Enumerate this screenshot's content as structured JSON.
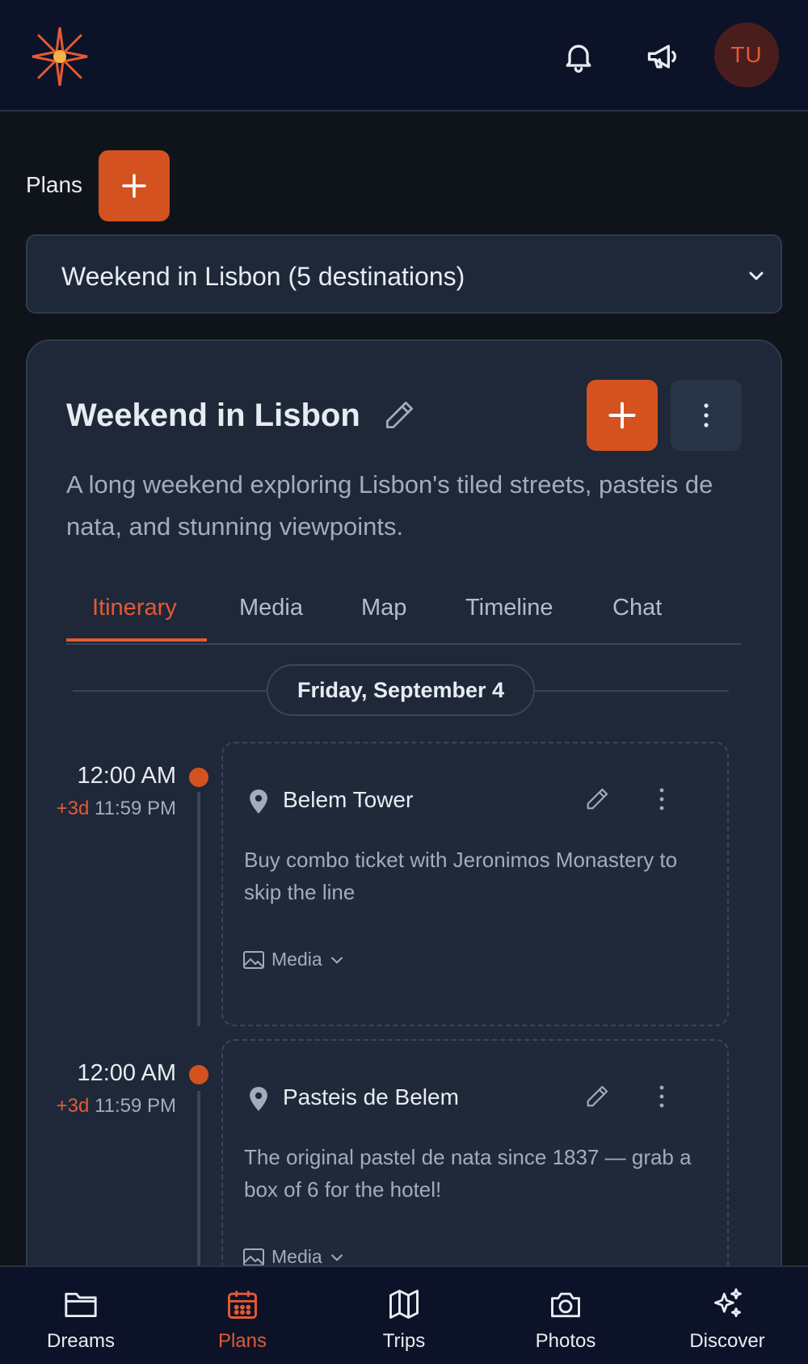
{
  "header": {
    "logo_icon": "sparkle-star-logo",
    "notifications_icon": "bell-icon",
    "announcements_icon": "megaphone-icon",
    "avatar_initials": "TU"
  },
  "plans": {
    "label": "Plans",
    "add_icon": "plus-icon",
    "selected_plan": "Weekend in Lisbon (5 destinations)"
  },
  "card": {
    "title": "Weekend in Lisbon",
    "description": "A long weekend exploring Lisbon's tiled streets, pasteis de nata, and stunning viewpoints.",
    "tabs": [
      {
        "label": "Itinerary",
        "active": true
      },
      {
        "label": "Media",
        "active": false
      },
      {
        "label": "Map",
        "active": false
      },
      {
        "label": "Timeline",
        "active": false
      },
      {
        "label": "Chat",
        "active": false
      }
    ],
    "date_label": "Friday, September 4"
  },
  "events": [
    {
      "start_time": "12:00 AM",
      "end_offset": "+3d",
      "end_time": "11:59 PM",
      "title": "Belem Tower",
      "description": "Buy combo ticket with Jeronimos Monastery to skip the line",
      "media_label": "Media"
    },
    {
      "start_time": "12:00 AM",
      "end_offset": "+3d",
      "end_time": "11:59 PM",
      "title": "Pasteis de Belem",
      "description": "The original pastel de nata since 1837 — grab a box of 6 for the hotel!",
      "media_label": "Media"
    }
  ],
  "bottom_nav": [
    {
      "label": "Dreams",
      "icon": "folder-icon",
      "active": false
    },
    {
      "label": "Plans",
      "icon": "calendar-icon",
      "active": true
    },
    {
      "label": "Trips",
      "icon": "map-icon",
      "active": false
    },
    {
      "label": "Photos",
      "icon": "camera-icon",
      "active": false
    },
    {
      "label": "Discover",
      "icon": "sparkles-icon",
      "active": false
    }
  ],
  "colors": {
    "accent": "#d4521f",
    "accent_text": "#e35a34",
    "background": "#0f141b",
    "card": "#1e2838",
    "header": "#0c1328"
  }
}
